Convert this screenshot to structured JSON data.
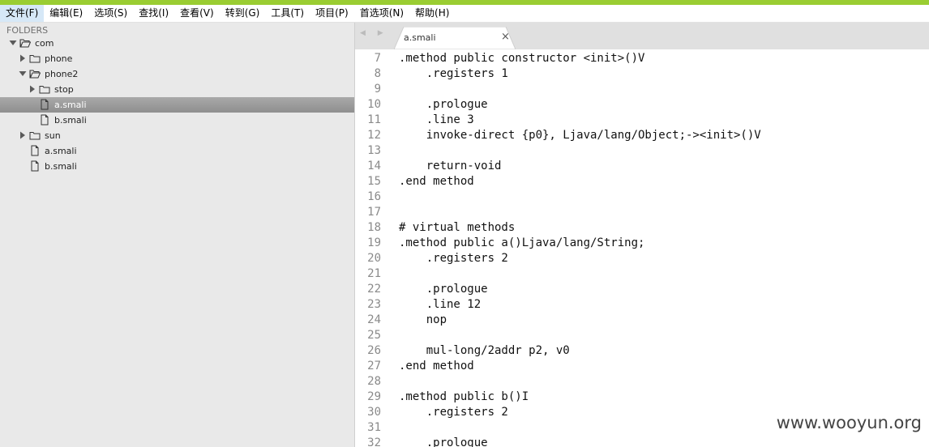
{
  "menu": [
    "文件(F)",
    "编辑(E)",
    "选项(S)",
    "查找(I)",
    "查看(V)",
    "转到(G)",
    "工具(T)",
    "项目(P)",
    "首选项(N)",
    "帮助(H)"
  ],
  "sidebar": {
    "header": "FOLDERS",
    "tree": [
      {
        "label": "com",
        "type": "folder",
        "depth": 0,
        "expanded": true
      },
      {
        "label": "phone",
        "type": "folder",
        "depth": 1,
        "expanded": false
      },
      {
        "label": "phone2",
        "type": "folder",
        "depth": 1,
        "expanded": true
      },
      {
        "label": "stop",
        "type": "folder",
        "depth": 2,
        "expanded": false
      },
      {
        "label": "a.smali",
        "type": "file",
        "depth": 2,
        "selected": true
      },
      {
        "label": "b.smali",
        "type": "file",
        "depth": 2
      },
      {
        "label": "sun",
        "type": "folder",
        "depth": 1,
        "expanded": false
      },
      {
        "label": "a.smali",
        "type": "file",
        "depth": 1
      },
      {
        "label": "b.smali",
        "type": "file",
        "depth": 1
      }
    ]
  },
  "tab": {
    "label": "a.smali",
    "close": "×",
    "nav": "◀ ▶"
  },
  "editor": {
    "lines": [
      {
        "n": "7",
        "text": ".method public constructor <init>()V"
      },
      {
        "n": "8",
        "text": "    .registers 1"
      },
      {
        "n": "9",
        "text": ""
      },
      {
        "n": "10",
        "text": "    .prologue"
      },
      {
        "n": "11",
        "text": "    .line 3"
      },
      {
        "n": "12",
        "text": "    invoke-direct {p0}, Ljava/lang/Object;-><init>()V"
      },
      {
        "n": "13",
        "text": ""
      },
      {
        "n": "14",
        "text": "    return-void"
      },
      {
        "n": "15",
        "text": ".end method"
      },
      {
        "n": "16",
        "text": ""
      },
      {
        "n": "17",
        "text": ""
      },
      {
        "n": "18",
        "text": "# virtual methods"
      },
      {
        "n": "19",
        "text": ".method public a()Ljava/lang/String;"
      },
      {
        "n": "20",
        "text": "    .registers 2"
      },
      {
        "n": "21",
        "text": ""
      },
      {
        "n": "22",
        "text": "    .prologue"
      },
      {
        "n": "23",
        "text": "    .line 12"
      },
      {
        "n": "24",
        "text": "    nop"
      },
      {
        "n": "25",
        "text": ""
      },
      {
        "n": "26",
        "text": "    mul-long/2addr p2, v0"
      },
      {
        "n": "27",
        "text": ".end method"
      },
      {
        "n": "28",
        "text": ""
      },
      {
        "n": "29",
        "text": ".method public b()I"
      },
      {
        "n": "30",
        "text": "    .registers 2"
      },
      {
        "n": "31",
        "text": ""
      },
      {
        "n": "32",
        "text": "    .prologue"
      }
    ]
  },
  "watermark": "www.wooyun.org",
  "colors": {
    "accent": "#9acd32",
    "sidebar_bg": "#e9e9e9",
    "selection": "#999999"
  }
}
